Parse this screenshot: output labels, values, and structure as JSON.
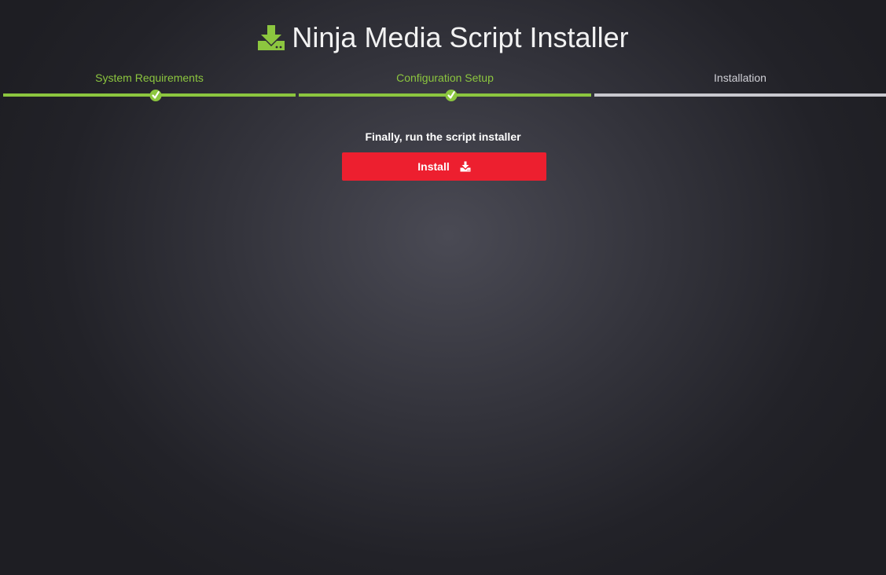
{
  "header": {
    "title": "Ninja Media Script Installer",
    "icon": "download-drive-icon",
    "icon_color": "#8cc63f"
  },
  "steps": [
    {
      "label": "System Requirements",
      "status": "complete"
    },
    {
      "label": "Configuration Setup",
      "status": "complete"
    },
    {
      "label": "Installation",
      "status": "current"
    }
  ],
  "main": {
    "instruction": "Finally, run the script installer",
    "install_button": {
      "label": "Install",
      "icon": "download-icon",
      "color": "#ed1f2f"
    }
  },
  "colors": {
    "accent": "#8cc63f",
    "pending": "#c9c9cf",
    "danger": "#ed1f2f"
  }
}
